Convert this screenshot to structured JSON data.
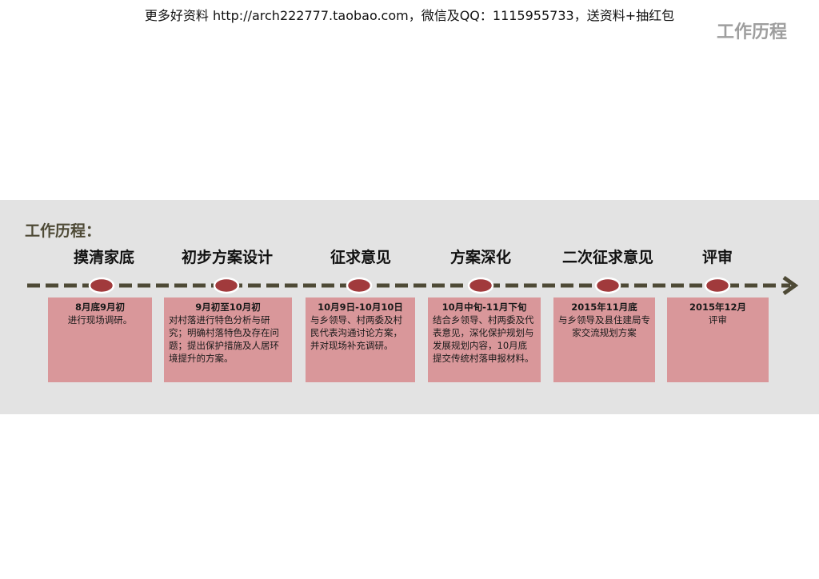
{
  "header": {
    "watermark": "更多好资料 http://arch222777.taobao.com，微信及QQ：1115955733，送资料+抽红包",
    "page_title": "工作历程"
  },
  "section": {
    "label": "工作历程："
  },
  "colors": {
    "band": "#e3e3e3",
    "timeline": "#4e4a36",
    "node": "#a13a3c",
    "box": "#d9979a"
  },
  "stages": [
    {
      "title": "摸清家底",
      "date": "8月底9月初",
      "desc": "进行现场调研。"
    },
    {
      "title": "初步方案设计",
      "date": "9月初至10月初",
      "desc": "对村落进行特色分析与研究；明确村落特色及存在问题；提出保护措施及人居环境提升的方案。"
    },
    {
      "title": "征求意见",
      "date": "10月9日-10月10日",
      "desc": "与乡领导、村两委及村民代表沟通讨论方案，并对现场补充调研。"
    },
    {
      "title": "方案深化",
      "date": "10月中旬-11月下旬",
      "desc": "结合乡领导、村两委及代表意见，深化保护规划与发展规划内容，10月底提交传统村落申报材料。"
    },
    {
      "title": "二次征求意见",
      "date": "2015年11月底",
      "desc": "与乡领导及县住建局专家交流规划方案"
    },
    {
      "title": "评审",
      "date": "2015年12月",
      "desc": "评审"
    }
  ]
}
